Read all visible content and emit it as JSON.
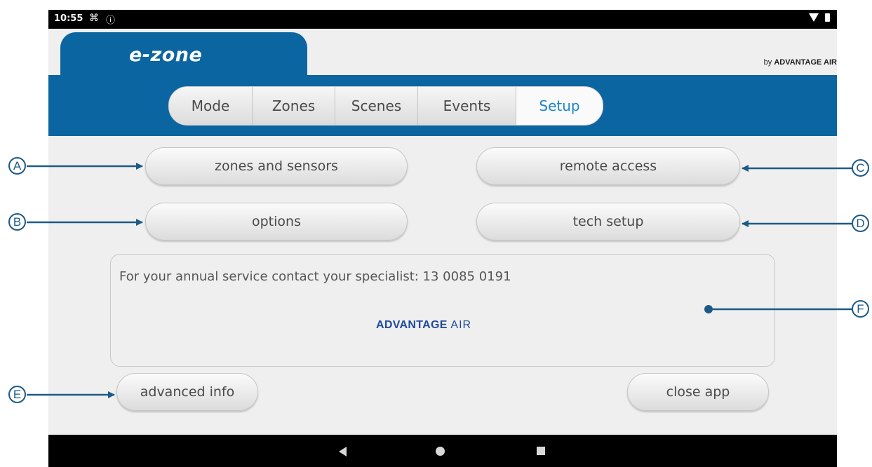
{
  "status_bar": {
    "time": "10:55",
    "icons": [
      "usb-debug-icon",
      "info-icon",
      "wifi-icon",
      "battery-icon"
    ]
  },
  "app": {
    "logo": "e-zone",
    "brand_small_prefix": "by ",
    "brand_small_name": "ADVANTAGE AIR",
    "accent_color": "#0a65a0",
    "active_tab_color": "#1c84c6"
  },
  "tabs": [
    {
      "label": "Mode",
      "active": false
    },
    {
      "label": "Zones",
      "active": false
    },
    {
      "label": "Scenes",
      "active": false
    },
    {
      "label": "Events",
      "active": false
    },
    {
      "label": "Setup",
      "active": true
    }
  ],
  "setup": {
    "zones_sensors_label": "zones and sensors",
    "remote_access_label": "remote access",
    "options_label": "options",
    "tech_setup_label": "tech setup",
    "advanced_info_label": "advanced info",
    "close_app_label": "close app"
  },
  "info_box": {
    "service_text": "For your annual service contact your specialist: 13 0085 0191",
    "logo_word1": "ADVANTAGE",
    "logo_word2": "AIR"
  },
  "callouts": [
    {
      "label": "A"
    },
    {
      "label": "B"
    },
    {
      "label": "C"
    },
    {
      "label": "D"
    },
    {
      "label": "E"
    },
    {
      "label": "F"
    }
  ],
  "callout_color": "#1d5a86"
}
